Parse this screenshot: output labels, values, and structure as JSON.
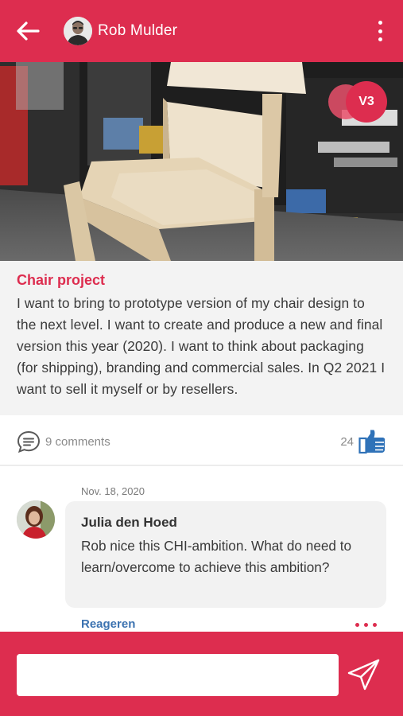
{
  "header": {
    "title": "Rob Mulder",
    "back_icon": "arrow-left-icon",
    "more_icon": "more-vertical-icon",
    "background": "#dd2d4f"
  },
  "post": {
    "version_badge": "V3",
    "project_title": "Chair project",
    "project_body": "I want to bring to prototype version of my chair design to the next level. I want to create and produce a new and final version this year (2020). I want to think about packaging (for shipping), branding and commercial sales. In Q2 2021 I want to sell it myself or by resellers.",
    "comments_count": "9 comments",
    "likes_count": "24"
  },
  "comment": {
    "date": "Nov. 18, 2020",
    "author": "Julia den Hoed",
    "text": "Rob nice this CHI-ambition. What do need to learn/overcome to achieve this ambition?",
    "reply_label": "Reageren"
  },
  "composer": {
    "value": "",
    "placeholder": "",
    "send_icon": "send-icon"
  },
  "colors": {
    "accent": "#dd2d4f",
    "link": "#3b72b0",
    "like_icon": "#2f72b8"
  }
}
